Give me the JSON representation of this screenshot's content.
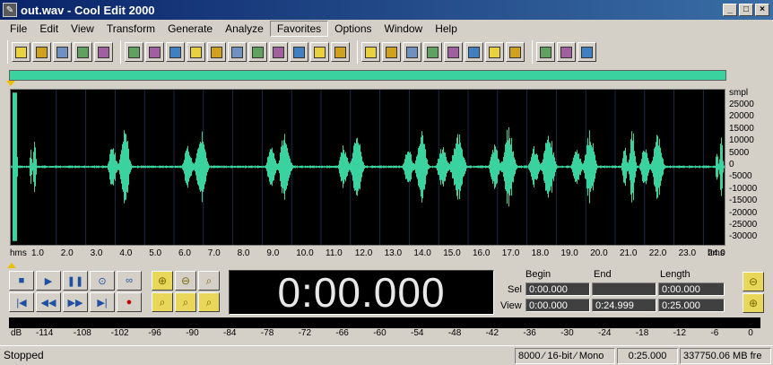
{
  "window": {
    "title": "out.wav - Cool Edit 2000",
    "controls": [
      "_",
      "□",
      "×"
    ]
  },
  "menu": [
    "File",
    "Edit",
    "View",
    "Transform",
    "Generate",
    "Analyze",
    "Favorites",
    "Options",
    "Window",
    "Help"
  ],
  "toolbar": {
    "groups": [
      [
        "new-file-icon",
        "open-folder-icon",
        "save-icon",
        "save-all-icon",
        "close-icon"
      ],
      [
        "undo-icon",
        "repeat-icon",
        "mix-icon",
        "wave-icon",
        "copy-icon",
        "cut-icon",
        "paste-icon",
        "paste-new-icon",
        "trim-icon",
        "mixpaste-icon",
        "play-icon"
      ],
      [
        "spectral-icon",
        "check-icon",
        "grid1-icon",
        "grid2-icon",
        "grid3-icon",
        "info-icon",
        "properties-icon",
        "cd-icon"
      ],
      [
        "frequency-icon",
        "script-icon",
        "help-icon"
      ]
    ]
  },
  "waveform": {
    "sample_unit": "smpl",
    "sample_ticks": [
      "25000",
      "20000",
      "15000",
      "10000",
      "5000",
      "0",
      "-5000",
      "-10000",
      "-15000",
      "-20000",
      "-25000",
      "-30000"
    ],
    "time_unit_left": "hms",
    "time_unit_right": "hms",
    "time_ticks": [
      "1.0",
      "2.0",
      "3.0",
      "4.0",
      "5.0",
      "6.0",
      "7.0",
      "8.0",
      "9.0",
      "10.0",
      "11.0",
      "12.0",
      "13.0",
      "14.0",
      "15.0",
      "16.0",
      "17.0",
      "18.0",
      "19.0",
      "20.0",
      "21.0",
      "22.0",
      "23.0",
      "24.0"
    ],
    "wave_color": "#3ad3a0"
  },
  "timer": {
    "display": "0:00.000"
  },
  "selection": {
    "headers": {
      "begin": "Begin",
      "end": "End",
      "length": "Length"
    },
    "sel_label": "Sel",
    "view_label": "View",
    "sel": {
      "begin": "0:00.000",
      "end": "",
      "length": "0:00.000"
    },
    "view": {
      "begin": "0:00.000",
      "end": "0:24.999",
      "length": "0:25.000"
    }
  },
  "meter": {
    "db_label": "dB",
    "ticks": [
      "-114",
      "-108",
      "-102",
      "-96",
      "-90",
      "-84",
      "-78",
      "-72",
      "-66",
      "-60",
      "-54",
      "-48",
      "-42",
      "-36",
      "-30",
      "-24",
      "-18",
      "-12",
      "-6",
      "0"
    ]
  },
  "status": {
    "state": "Stopped",
    "format": "8000 ⁄ 16-bit ⁄ Mono",
    "duration": "0:25.000",
    "free": "337750.06 MB fre"
  }
}
